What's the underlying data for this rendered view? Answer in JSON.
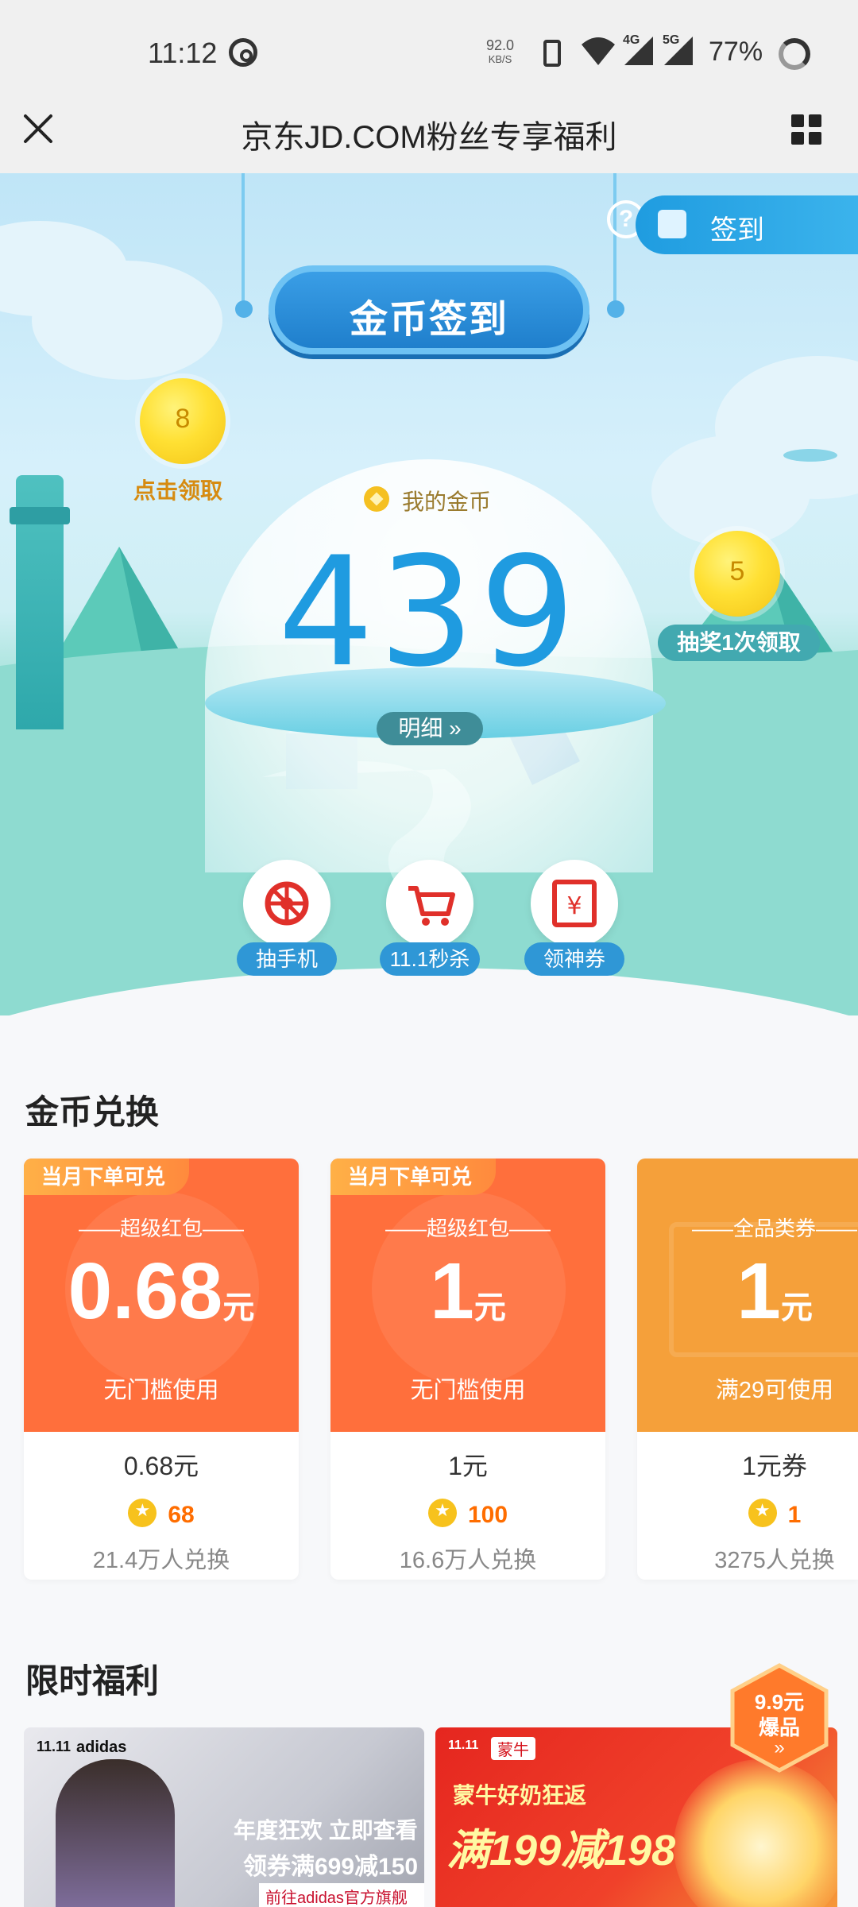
{
  "status_bar": {
    "time": "11:12",
    "net_speed_value": "92.0",
    "net_speed_unit": "KB/S",
    "sig1_label": "4G",
    "sig2_label": "5G",
    "battery": "77%"
  },
  "nav": {
    "title": "京东JD.COM粉丝专享福利"
  },
  "hero": {
    "sign_in_label": "签到",
    "banner_title": "金币签到",
    "left_bubble": {
      "value": "8",
      "label": "点击领取"
    },
    "right_bubble": {
      "value": "5",
      "label": "抽奖1次领取"
    },
    "my_coins_label": "我的金币",
    "my_coins_value": "439",
    "detail_label": "明细 »",
    "quick_actions": [
      {
        "label": "抽手机",
        "icon": "lottery-wheel-icon"
      },
      {
        "label": "11.1秒杀",
        "icon": "shopping-cart-icon"
      },
      {
        "label": "领神券",
        "icon": "yuan-coupon-icon"
      }
    ]
  },
  "exchange": {
    "title": "金币兑换",
    "cards": [
      {
        "tag": "当月下单可兑",
        "type": "——超级红包——",
        "amount": "0.68",
        "unit": "元",
        "cond": "无门槛使用",
        "name": "0.68元",
        "cost": "68",
        "count": "21.4万人兑换",
        "color": "#ff6f3c"
      },
      {
        "tag": "当月下单可兑",
        "type": "——超级红包——",
        "amount": "1",
        "unit": "元",
        "cond": "无门槛使用",
        "name": "1元",
        "cost": "100",
        "count": "16.6万人兑换",
        "color": "#ff6f3c"
      },
      {
        "tag": "",
        "type": "——全品类券——",
        "amount": "1",
        "unit": "元",
        "cond": "满29可使用",
        "name": "1元券",
        "cost": "1",
        "count": "3275人兑换",
        "color": "#f5a03a"
      }
    ]
  },
  "limited": {
    "title": "限时福利",
    "badge_line1": "9.9元",
    "badge_line2": "爆品",
    "promo1": {
      "brand_tag": "11.11",
      "brand": "adidas",
      "line1": "年度狂欢 立即查看",
      "line2": "领券满699减150",
      "line3": "前往adidas官方旗舰店"
    },
    "promo2": {
      "brand_tag": "11.11",
      "brand": "蒙牛",
      "line1": "蒙牛好奶狂返",
      "line2": "满199减198"
    }
  },
  "colors": {
    "accent_blue": "#1f9be0",
    "coupon_red": "#ff6f3c",
    "coupon_orange": "#f5a03a",
    "coin_gold": "#f7c21d"
  }
}
